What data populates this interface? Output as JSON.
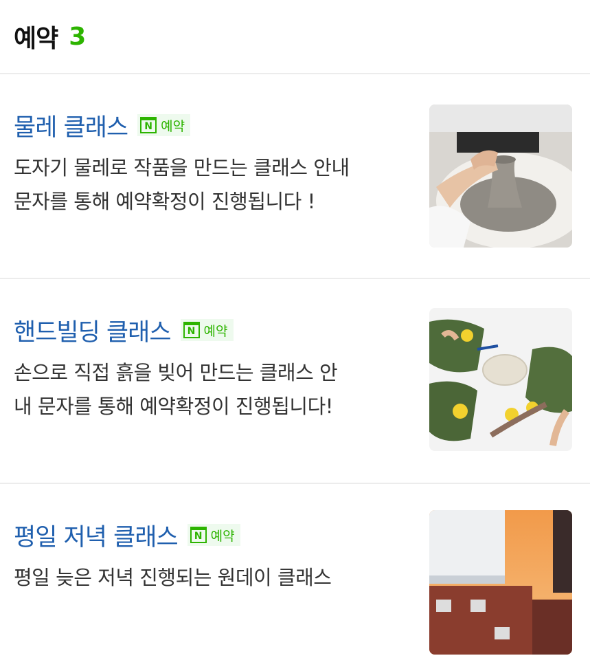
{
  "header": {
    "title": "예약",
    "count": "3"
  },
  "badge_label": "예약",
  "badge_icon_letter": "N",
  "items": [
    {
      "title": "물레 클래스",
      "desc_line1": "도자기 물레로 작품을 만드는 클래스 안내",
      "desc_line2": "문자를 통해 예약확정이 진행됩니다 !",
      "thumb_icon": "pottery-wheel-photo"
    },
    {
      "title": "핸드빌딩 클래스",
      "desc_line1": "손으로 직접 흙을 빚어 만드는 클래스 안",
      "desc_line2": "내 문자를 통해 예약확정이 진행됩니다!",
      "thumb_icon": "handbuilding-table-photo"
    },
    {
      "title": "평일 저녁 클래스",
      "desc_line1": "평일 늦은 저녁 진행되는 원데이 클래스",
      "desc_line2": "",
      "thumb_icon": "building-sunset-photo"
    }
  ],
  "colors": {
    "title_blue": "#1f5fae",
    "naver_green": "#2db400",
    "divider": "#ececec"
  }
}
